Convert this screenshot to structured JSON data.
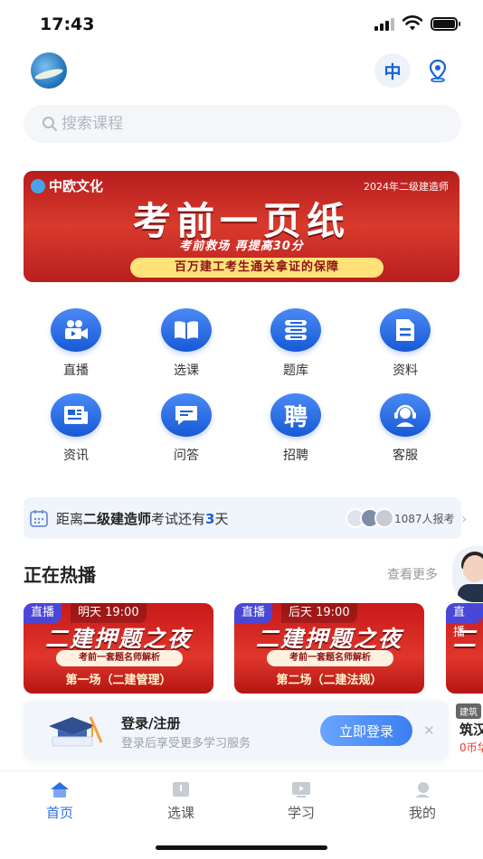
{
  "status_bar": {
    "time": "17:43"
  },
  "header": {
    "lang_label": "中",
    "location_icon": "location-pin-icon"
  },
  "search": {
    "placeholder": "搜索课程"
  },
  "banner": {
    "brand": "中欧文化",
    "year_label": "2024年二级建造师",
    "title": "考前一页纸",
    "subtitle": "考前救场 再提高30分",
    "tagline": "百万建工考生通关拿证的保障"
  },
  "menu": {
    "items": [
      {
        "label": "直播",
        "icon": "video-camera-icon"
      },
      {
        "label": "选课",
        "icon": "open-book-icon"
      },
      {
        "label": "题库",
        "icon": "question-bank-icon"
      },
      {
        "label": "资料",
        "icon": "document-icon"
      },
      {
        "label": "资讯",
        "icon": "news-icon"
      },
      {
        "label": "问答",
        "icon": "chat-icon"
      },
      {
        "label": "招聘",
        "icon": "recruit-icon"
      },
      {
        "label": "客服",
        "icon": "customer-service-icon"
      }
    ]
  },
  "countdown": {
    "prefix": "距离",
    "exam": "二级建造师",
    "middle": "考试还有",
    "days": "3",
    "suffix": "天",
    "signups": "1087人报考"
  },
  "live": {
    "title": "正在热播",
    "see_more": "查看更多",
    "cards": [
      {
        "badge": "直播",
        "time": "明天 19:00",
        "title": "二建押题之夜",
        "sub": "考前一套题名师解析",
        "session": "第一场（二建管理）"
      },
      {
        "badge": "直播",
        "time": "后天 19:00",
        "title": "二建押题之夜",
        "sub": "考前一套题名师解析",
        "session": "第二场（二建法规）"
      },
      {
        "badge": "直播",
        "time": "",
        "title": "二",
        "sub": "",
        "session": ""
      }
    ],
    "side_card": {
      "tag": "建筑",
      "title": "筑汉",
      "price": "0币华"
    }
  },
  "login_prompt": {
    "title": "登录/注册",
    "subtitle": "登录后享受更多学习服务",
    "button": "立即登录"
  },
  "tabbar": {
    "tabs": [
      {
        "label": "首页",
        "icon": "home-icon",
        "active": true
      },
      {
        "label": "选课",
        "icon": "book-icon",
        "active": false
      },
      {
        "label": "学习",
        "icon": "play-icon",
        "active": false
      },
      {
        "label": "我的",
        "icon": "user-icon",
        "active": false
      }
    ]
  },
  "colors": {
    "accent": "#1a5fd9",
    "live_badge": "#4a47d8",
    "banner_red": "#c81a1a"
  }
}
